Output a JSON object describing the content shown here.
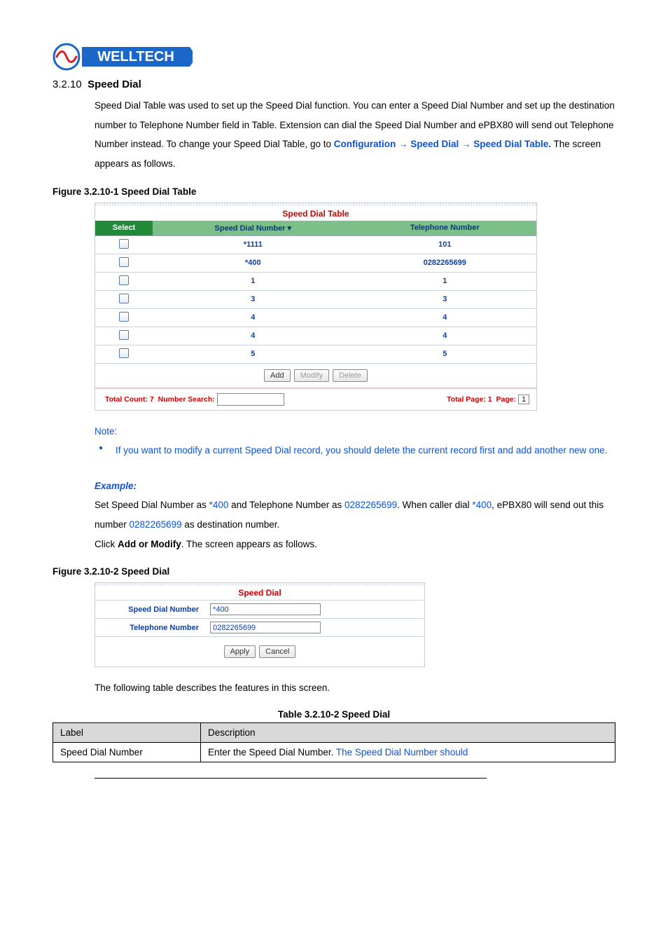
{
  "logo": {
    "brand": "WELLTECH"
  },
  "section": {
    "number": "3.2.10",
    "title": "Speed Dial"
  },
  "intro": {
    "pre": "Speed Dial Table was used to set up the Speed Dial function. You can enter a Speed Dial Number and set up the destination number to Telephone Number field in Table. Extension can dial the Speed Dial Number and ePBX80 will send out Telephone Number instead. To change your Speed Dial Table, go to ",
    "link": "Configuration → Speed Dial → Speed Dial Table.",
    "post": " The screen appears as follows."
  },
  "fig1": {
    "caption": "Figure   3.2.10-1 Speed Dial Table",
    "title": "Speed Dial Table",
    "headers": {
      "select": "Select",
      "number": "Speed Dial Number",
      "tel": "Telephone Number"
    },
    "rows": [
      {
        "number": "*1111",
        "tel": "101"
      },
      {
        "number": "*400",
        "tel": "0282265699"
      },
      {
        "number": "1",
        "tel": "1"
      },
      {
        "number": "3",
        "tel": "3"
      },
      {
        "number": "4",
        "tel": "4"
      },
      {
        "number": "4",
        "tel": "4"
      },
      {
        "number": "5",
        "tel": "5"
      }
    ],
    "buttons": {
      "add": "Add",
      "modify": "Modify",
      "delete": "Delete"
    },
    "footer": {
      "total_count_label": "Total Count:",
      "total_count_value": "7",
      "search_label": "Number Search:",
      "total_page_label": "Total Page:",
      "total_page_value": "1",
      "page_label": "Page:",
      "page_value": "1"
    }
  },
  "note": {
    "title": "Note:",
    "item": "If you want to modify a current Speed Dial record, you should delete the current record first and add another new one."
  },
  "example": {
    "title": "Example:",
    "line1_a": "Set Speed Dial Number as ",
    "line1_b": "*400",
    "line1_c": " and Telephone Number as ",
    "line1_d": "0282265699",
    "line1_e": ". When caller dial ",
    "line2_a": "*400",
    "line2_b": ", ePBX80 will send out this number ",
    "line2_c": "0282265699",
    "line2_d": " as destination number.",
    "line3_a": "Click ",
    "line3_b": "Add or Modify",
    "line3_c": ". The screen appears as follows."
  },
  "fig2": {
    "caption": "Figure   3.2.10-2 Speed Dial",
    "title": "Speed Dial",
    "fields": {
      "sdn_label": "Speed Dial Number",
      "sdn_value": "*400",
      "tel_label": "Telephone Number",
      "tel_value": "0282265699"
    },
    "buttons": {
      "apply": "Apply",
      "cancel": "Cancel"
    }
  },
  "after_fig2": "The following table describes the features in this screen.",
  "table": {
    "caption": "Table 3.2.10-2 Speed Dial",
    "hdr_label": "Label",
    "hdr_desc": "Description",
    "row1_label": "Speed Dial Number",
    "row1_desc_a": "Enter the Speed Dial Number. ",
    "row1_desc_b": "The Speed Dial Number should"
  }
}
